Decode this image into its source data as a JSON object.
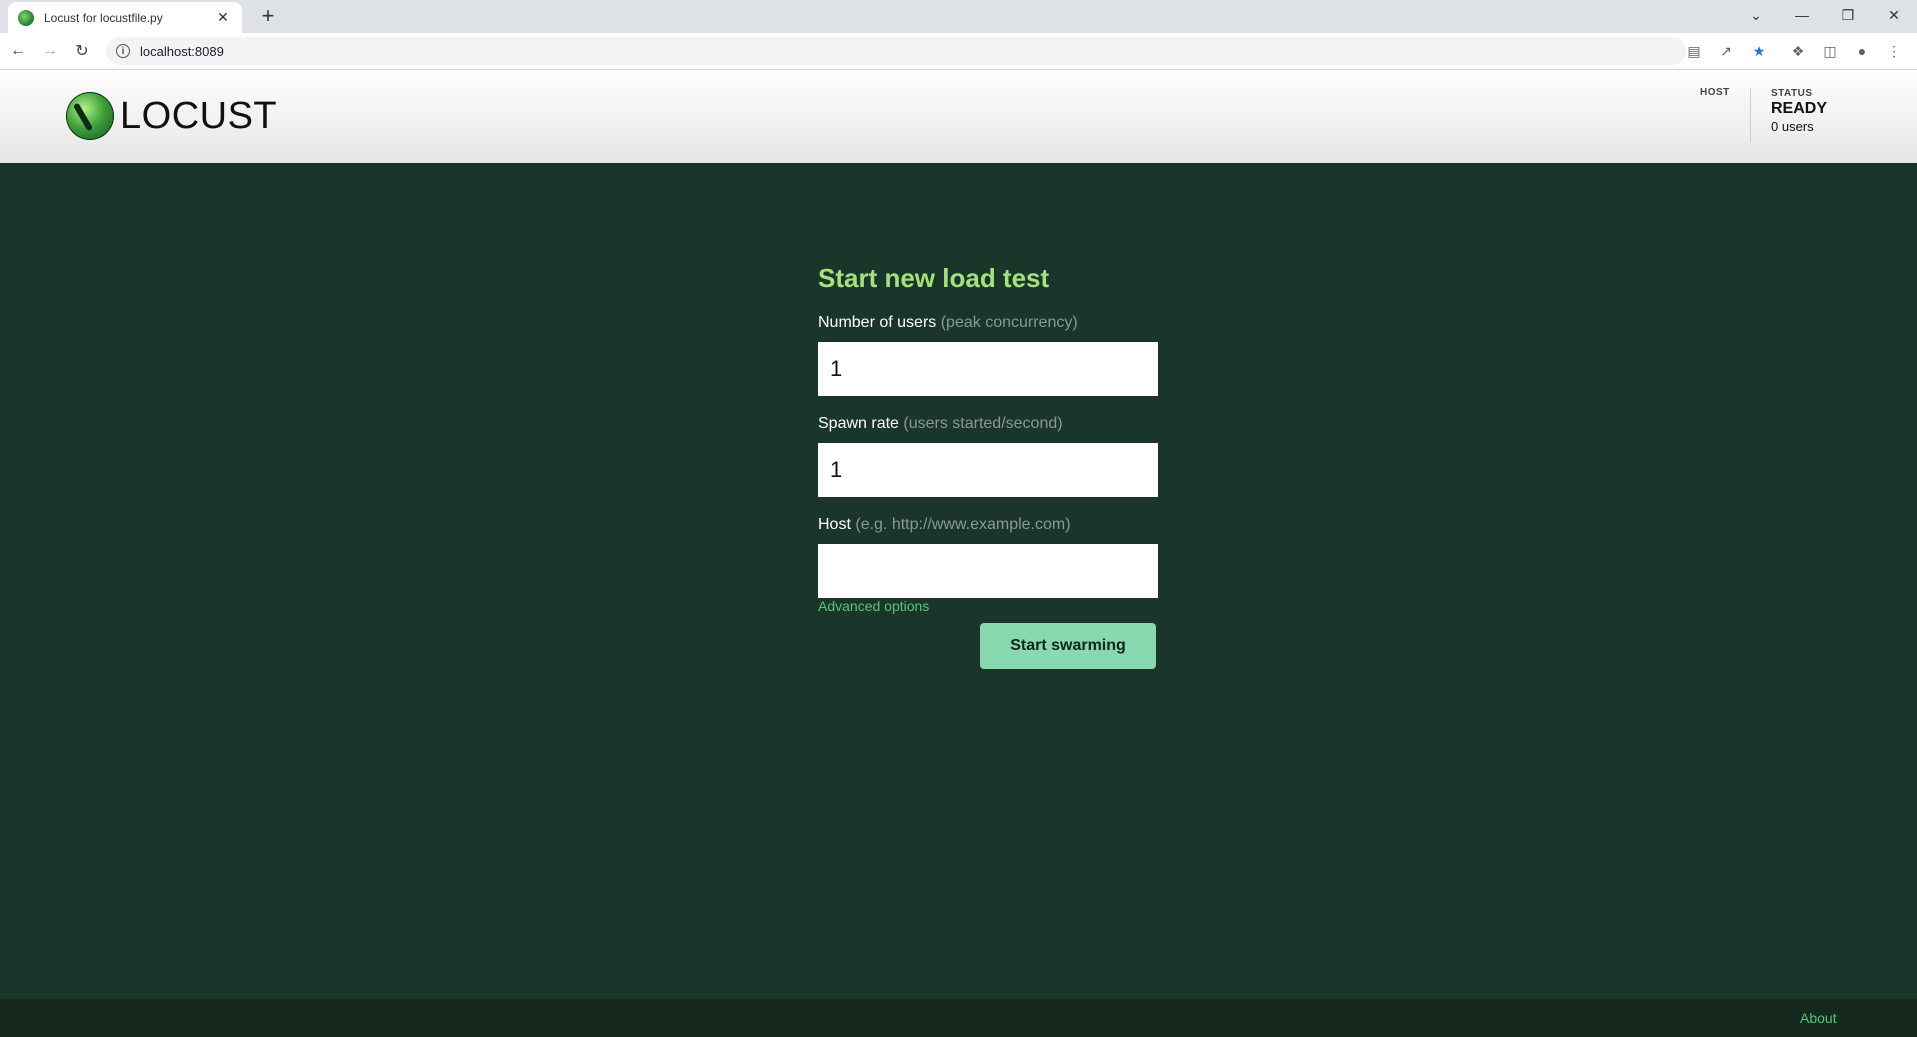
{
  "browser": {
    "tab_title": "Locust for locustfile.py",
    "tab_close": "✕",
    "new_tab": "+",
    "url": "localhost:8089",
    "window_controls": [
      "⌄",
      "—",
      "❐",
      "✕"
    ]
  },
  "header": {
    "logo_text": "LOCUST",
    "host_label": "HOST",
    "status_label": "STATUS",
    "status_value": "READY",
    "users_count": "0 users"
  },
  "form": {
    "title": "Start new load test",
    "users_label": "Number of users",
    "users_hint": "(peak concurrency)",
    "users_value": "1",
    "spawn_label": "Spawn rate",
    "spawn_hint": "(users started/second)",
    "spawn_value": "1",
    "host_label": "Host",
    "host_hint": "(e.g. http://www.example.com)",
    "host_value": "",
    "advanced_link": "Advanced options",
    "submit_label": "Start swarming"
  },
  "footer": {
    "about_link": "About"
  },
  "colors": {
    "background": "#1a3529",
    "accent_title": "#a4e07c",
    "button": "#88d8b0",
    "link": "#57c77b"
  }
}
